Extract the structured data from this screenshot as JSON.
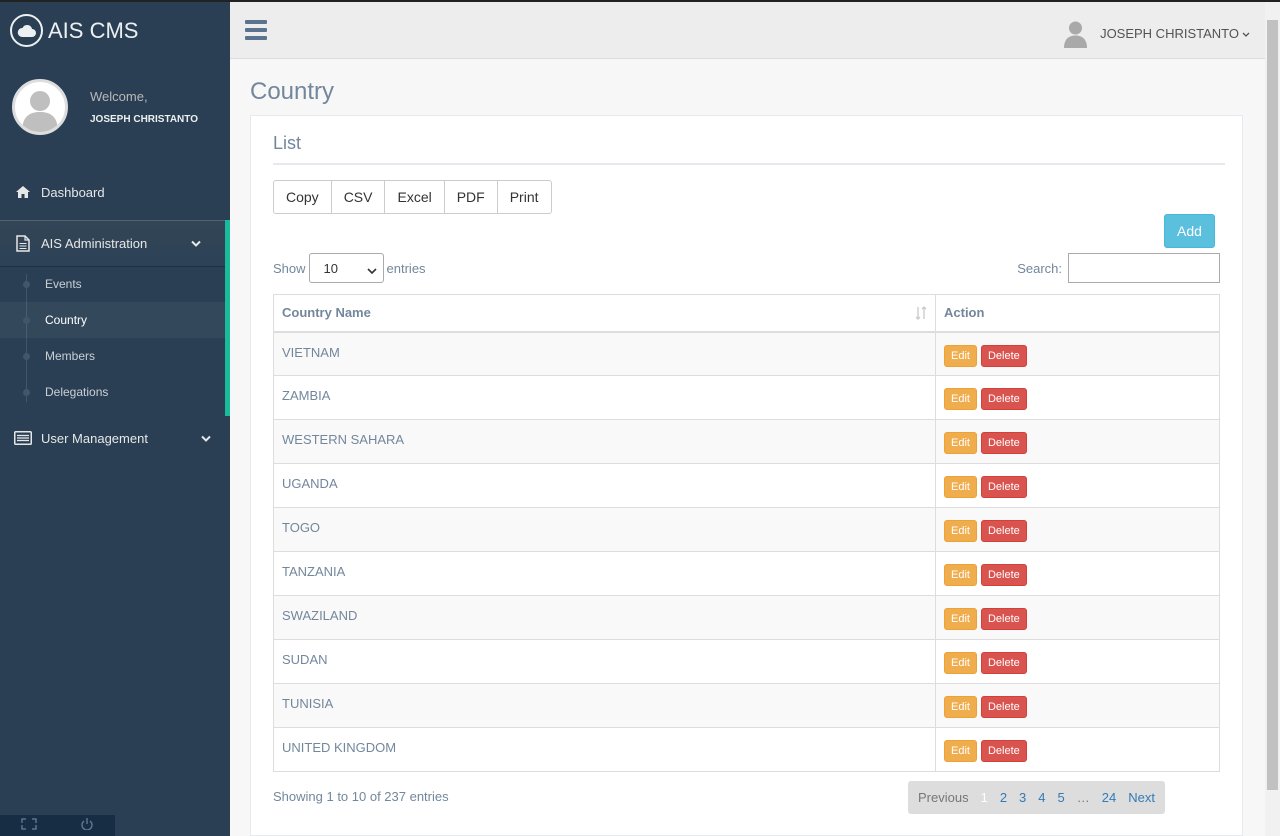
{
  "brand": {
    "title": "AIS CMS"
  },
  "profile": {
    "welcome": "Welcome,",
    "name": "JOSEPH CHRISTANTO"
  },
  "sidebar": {
    "items": [
      {
        "label": "Dashboard",
        "icon": "home-icon"
      },
      {
        "label": "AIS Administration",
        "icon": "document-icon"
      },
      {
        "label": "User Management",
        "icon": "list-icon"
      }
    ],
    "sub_items": [
      "Events",
      "Country",
      "Members",
      "Delegations"
    ]
  },
  "topnav": {
    "user": "JOSEPH CHRISTANTO"
  },
  "page": {
    "title": "Country"
  },
  "panel": {
    "title": "List",
    "export_buttons": [
      "Copy",
      "CSV",
      "Excel",
      "PDF",
      "Print"
    ],
    "add_label": "Add"
  },
  "controls": {
    "show_label": "Show",
    "entries_value": "10",
    "entries_label": "entries",
    "search_label": "Search:"
  },
  "table": {
    "headers": [
      "Country Name",
      "Action"
    ],
    "rows": [
      "VIETNAM",
      "ZAMBIA",
      "WESTERN SAHARA",
      "UGANDA",
      "TOGO",
      "TANZANIA",
      "SWAZILAND",
      "SUDAN",
      "TUNISIA",
      "UNITED KINGDOM"
    ],
    "edit_label": "Edit",
    "delete_label": "Delete"
  },
  "footer": {
    "info": "Showing 1 to 10 of 237 entries",
    "pager": {
      "previous": "Previous",
      "pages": [
        "1",
        "2",
        "3",
        "4",
        "5"
      ],
      "ellipsis": "…",
      "last": "24",
      "next": "Next",
      "current": "1"
    }
  },
  "colors": {
    "sidebar": "#2a3f54",
    "accent": "#1abb9c",
    "edit": "#f0ad4e",
    "delete": "#d9534f",
    "add": "#5bc0de"
  }
}
